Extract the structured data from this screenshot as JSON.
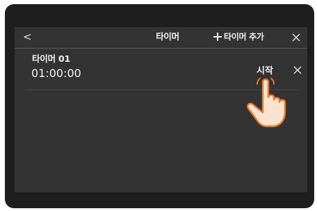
{
  "header": {
    "back_icon": "chevron-left-icon",
    "title": "타이머",
    "add_label": "타이머 추가",
    "add_icon": "plus-icon",
    "close_icon": "close-icon"
  },
  "timers": [
    {
      "name": "타이머 01",
      "time": "01:00:00",
      "start_label": "시작"
    }
  ],
  "overlay": {
    "pointer_icon": "tap-hand-icon"
  },
  "colors": {
    "bezel": "#1e1e1e",
    "screen": "#333333",
    "text": "#f2f2f2",
    "hand_fill": "#fbe3cf",
    "hand_stroke": "#e8782a"
  }
}
